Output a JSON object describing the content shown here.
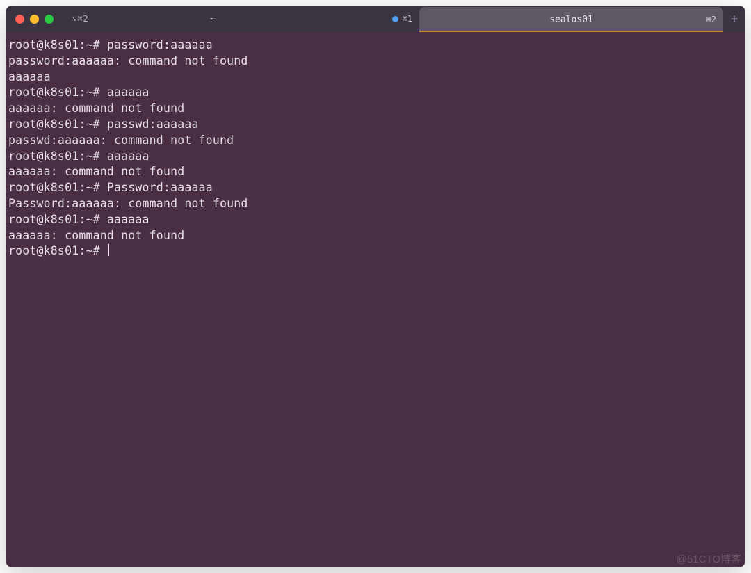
{
  "titlebar": {
    "left_hint": "⌥⌘2",
    "left_title": "~",
    "left_status_glyph": "●",
    "left_status_hotkey": "⌘1",
    "tab_label": "sealos01",
    "tab_hotkey": "⌘2",
    "new_tab_glyph": "+"
  },
  "prompt_prefix": "root@k8s01:~# ",
  "terminal": {
    "lines": [
      "root@k8s01:~# password:aaaaaa",
      "password:aaaaaa: command not found",
      "aaaaaa",
      "root@k8s01:~# aaaaaa",
      "aaaaaa: command not found",
      "root@k8s01:~# passwd:aaaaaa",
      "passwd:aaaaaa: command not found",
      "root@k8s01:~# aaaaaa",
      "aaaaaa: command not found",
      "root@k8s01:~# Password:aaaaaa",
      "Password:aaaaaa: command not found",
      "root@k8s01:~# aaaaaa",
      "aaaaaa: command not found"
    ],
    "current_prompt": "root@k8s01:~# "
  },
  "watermark": "@51CTO博客"
}
